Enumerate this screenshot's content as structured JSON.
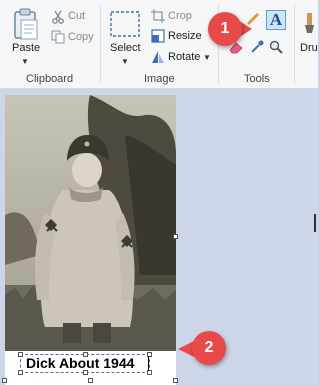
{
  "ribbon": {
    "clipboard": {
      "paste_label": "Paste",
      "cut_label": "Cut",
      "copy_label": "Copy",
      "group_label": "Clipboard"
    },
    "image": {
      "select_label": "Select",
      "crop_label": "Crop",
      "resize_label": "Resize",
      "rotate_label": "Rotate",
      "group_label": "Image"
    },
    "tools": {
      "group_label": "Tools",
      "text_tool_icon": "A"
    },
    "brushes": {
      "label": "Dru"
    }
  },
  "canvas": {
    "caption_text": "Dick About 1944"
  },
  "annotations": {
    "badge_1": "1",
    "badge_2": "2"
  },
  "colors": {
    "badge": "#e84a4a",
    "ribbon_bg": "#f5f6f7",
    "canvas_bg": "#cdd6e8",
    "selection_accent": "#4a6fa5"
  }
}
